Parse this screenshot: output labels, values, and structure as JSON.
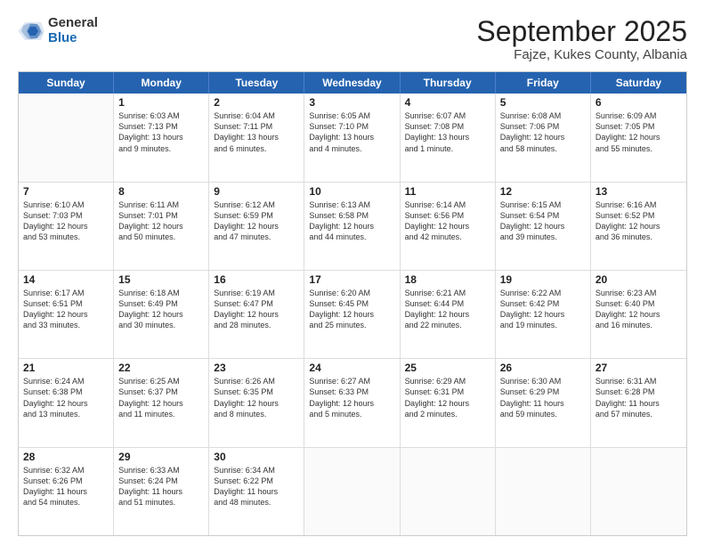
{
  "logo": {
    "general": "General",
    "blue": "Blue"
  },
  "header": {
    "title": "September 2025",
    "subtitle": "Fajze, Kukes County, Albania"
  },
  "days": [
    "Sunday",
    "Monday",
    "Tuesday",
    "Wednesday",
    "Thursday",
    "Friday",
    "Saturday"
  ],
  "weeks": [
    [
      {
        "day": "",
        "lines": []
      },
      {
        "day": "1",
        "lines": [
          "Sunrise: 6:03 AM",
          "Sunset: 7:13 PM",
          "Daylight: 13 hours",
          "and 9 minutes."
        ]
      },
      {
        "day": "2",
        "lines": [
          "Sunrise: 6:04 AM",
          "Sunset: 7:11 PM",
          "Daylight: 13 hours",
          "and 6 minutes."
        ]
      },
      {
        "day": "3",
        "lines": [
          "Sunrise: 6:05 AM",
          "Sunset: 7:10 PM",
          "Daylight: 13 hours",
          "and 4 minutes."
        ]
      },
      {
        "day": "4",
        "lines": [
          "Sunrise: 6:07 AM",
          "Sunset: 7:08 PM",
          "Daylight: 13 hours",
          "and 1 minute."
        ]
      },
      {
        "day": "5",
        "lines": [
          "Sunrise: 6:08 AM",
          "Sunset: 7:06 PM",
          "Daylight: 12 hours",
          "and 58 minutes."
        ]
      },
      {
        "day": "6",
        "lines": [
          "Sunrise: 6:09 AM",
          "Sunset: 7:05 PM",
          "Daylight: 12 hours",
          "and 55 minutes."
        ]
      }
    ],
    [
      {
        "day": "7",
        "lines": [
          "Sunrise: 6:10 AM",
          "Sunset: 7:03 PM",
          "Daylight: 12 hours",
          "and 53 minutes."
        ]
      },
      {
        "day": "8",
        "lines": [
          "Sunrise: 6:11 AM",
          "Sunset: 7:01 PM",
          "Daylight: 12 hours",
          "and 50 minutes."
        ]
      },
      {
        "day": "9",
        "lines": [
          "Sunrise: 6:12 AM",
          "Sunset: 6:59 PM",
          "Daylight: 12 hours",
          "and 47 minutes."
        ]
      },
      {
        "day": "10",
        "lines": [
          "Sunrise: 6:13 AM",
          "Sunset: 6:58 PM",
          "Daylight: 12 hours",
          "and 44 minutes."
        ]
      },
      {
        "day": "11",
        "lines": [
          "Sunrise: 6:14 AM",
          "Sunset: 6:56 PM",
          "Daylight: 12 hours",
          "and 42 minutes."
        ]
      },
      {
        "day": "12",
        "lines": [
          "Sunrise: 6:15 AM",
          "Sunset: 6:54 PM",
          "Daylight: 12 hours",
          "and 39 minutes."
        ]
      },
      {
        "day": "13",
        "lines": [
          "Sunrise: 6:16 AM",
          "Sunset: 6:52 PM",
          "Daylight: 12 hours",
          "and 36 minutes."
        ]
      }
    ],
    [
      {
        "day": "14",
        "lines": [
          "Sunrise: 6:17 AM",
          "Sunset: 6:51 PM",
          "Daylight: 12 hours",
          "and 33 minutes."
        ]
      },
      {
        "day": "15",
        "lines": [
          "Sunrise: 6:18 AM",
          "Sunset: 6:49 PM",
          "Daylight: 12 hours",
          "and 30 minutes."
        ]
      },
      {
        "day": "16",
        "lines": [
          "Sunrise: 6:19 AM",
          "Sunset: 6:47 PM",
          "Daylight: 12 hours",
          "and 28 minutes."
        ]
      },
      {
        "day": "17",
        "lines": [
          "Sunrise: 6:20 AM",
          "Sunset: 6:45 PM",
          "Daylight: 12 hours",
          "and 25 minutes."
        ]
      },
      {
        "day": "18",
        "lines": [
          "Sunrise: 6:21 AM",
          "Sunset: 6:44 PM",
          "Daylight: 12 hours",
          "and 22 minutes."
        ]
      },
      {
        "day": "19",
        "lines": [
          "Sunrise: 6:22 AM",
          "Sunset: 6:42 PM",
          "Daylight: 12 hours",
          "and 19 minutes."
        ]
      },
      {
        "day": "20",
        "lines": [
          "Sunrise: 6:23 AM",
          "Sunset: 6:40 PM",
          "Daylight: 12 hours",
          "and 16 minutes."
        ]
      }
    ],
    [
      {
        "day": "21",
        "lines": [
          "Sunrise: 6:24 AM",
          "Sunset: 6:38 PM",
          "Daylight: 12 hours",
          "and 13 minutes."
        ]
      },
      {
        "day": "22",
        "lines": [
          "Sunrise: 6:25 AM",
          "Sunset: 6:37 PM",
          "Daylight: 12 hours",
          "and 11 minutes."
        ]
      },
      {
        "day": "23",
        "lines": [
          "Sunrise: 6:26 AM",
          "Sunset: 6:35 PM",
          "Daylight: 12 hours",
          "and 8 minutes."
        ]
      },
      {
        "day": "24",
        "lines": [
          "Sunrise: 6:27 AM",
          "Sunset: 6:33 PM",
          "Daylight: 12 hours",
          "and 5 minutes."
        ]
      },
      {
        "day": "25",
        "lines": [
          "Sunrise: 6:29 AM",
          "Sunset: 6:31 PM",
          "Daylight: 12 hours",
          "and 2 minutes."
        ]
      },
      {
        "day": "26",
        "lines": [
          "Sunrise: 6:30 AM",
          "Sunset: 6:29 PM",
          "Daylight: 11 hours",
          "and 59 minutes."
        ]
      },
      {
        "day": "27",
        "lines": [
          "Sunrise: 6:31 AM",
          "Sunset: 6:28 PM",
          "Daylight: 11 hours",
          "and 57 minutes."
        ]
      }
    ],
    [
      {
        "day": "28",
        "lines": [
          "Sunrise: 6:32 AM",
          "Sunset: 6:26 PM",
          "Daylight: 11 hours",
          "and 54 minutes."
        ]
      },
      {
        "day": "29",
        "lines": [
          "Sunrise: 6:33 AM",
          "Sunset: 6:24 PM",
          "Daylight: 11 hours",
          "and 51 minutes."
        ]
      },
      {
        "day": "30",
        "lines": [
          "Sunrise: 6:34 AM",
          "Sunset: 6:22 PM",
          "Daylight: 11 hours",
          "and 48 minutes."
        ]
      },
      {
        "day": "",
        "lines": []
      },
      {
        "day": "",
        "lines": []
      },
      {
        "day": "",
        "lines": []
      },
      {
        "day": "",
        "lines": []
      }
    ]
  ]
}
